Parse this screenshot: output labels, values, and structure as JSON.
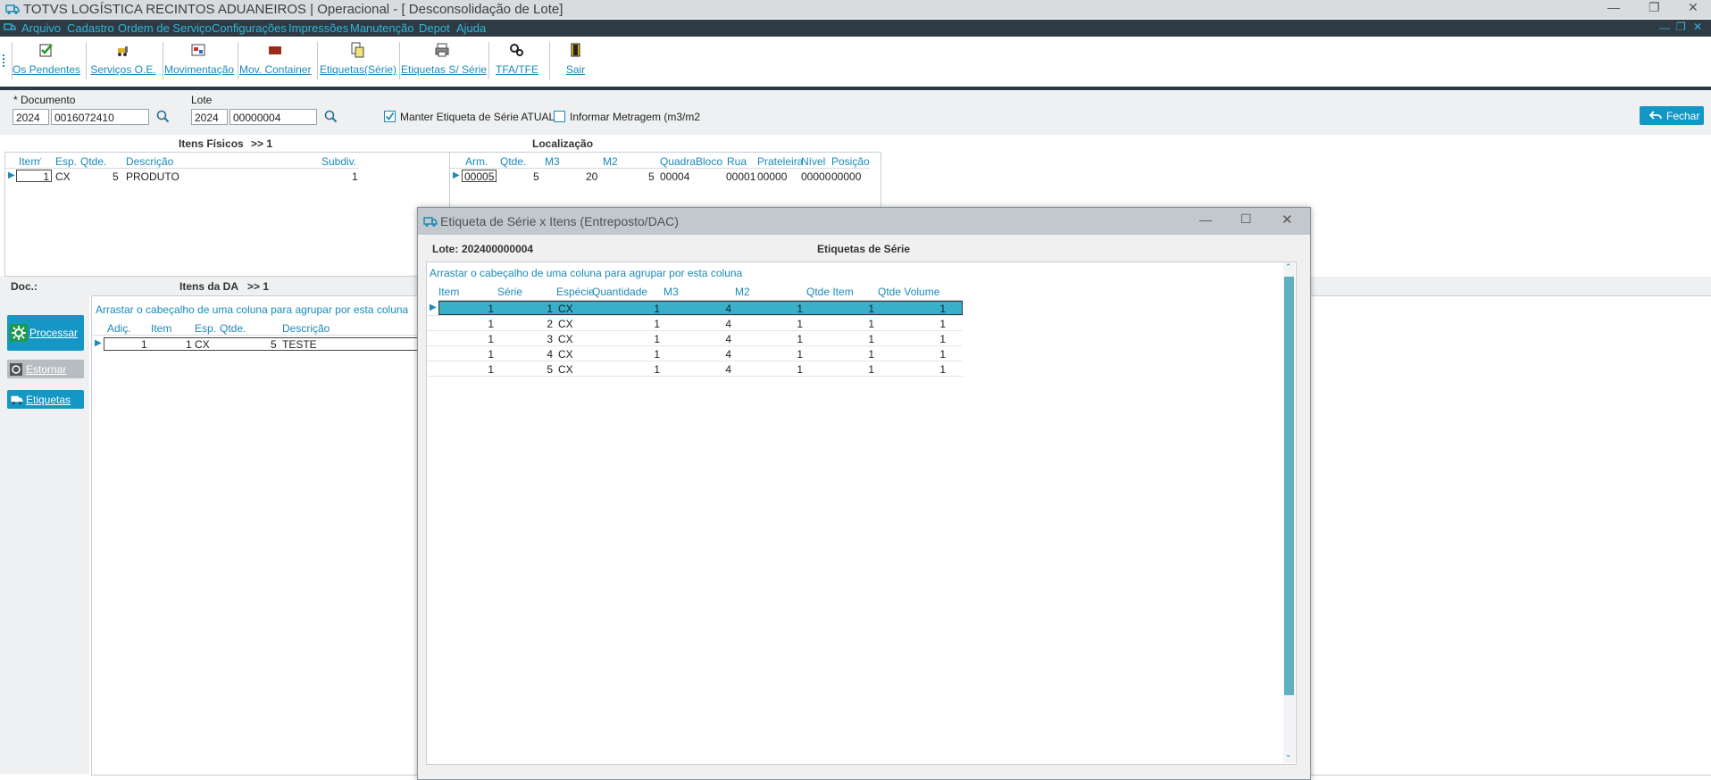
{
  "window": {
    "title": "TOTVS LOGÍSTICA RECINTOS ADUANEIROS | Operacional - [ Desconsolidação de Lote]"
  },
  "menu": [
    "Arquivo",
    "Cadastro",
    "Ordem de Serviço",
    "Configurações",
    "Impressões",
    "Manutenção",
    "Depot",
    "Ajuda"
  ],
  "toolbar": [
    "Os Pendentes",
    "Serviços O.E.",
    "Movimentação",
    "Mov. Container",
    "Etiquetas(Série)",
    "Etiquetas S/ Série",
    "TFA/TFE",
    "Sair"
  ],
  "form": {
    "documento_label": "* Documento",
    "documento_ano": "2024",
    "documento_num": "0016072410",
    "lote_label": "Lote",
    "lote_ano": "2024",
    "lote_num": "00000004",
    "chk1_label": "Manter Etiqueta de Série ATUAL",
    "chk2_label": "Informar Metragem (m3/m2",
    "fechar": "Fechar"
  },
  "itens_fisicos": {
    "title": "Itens Físicos",
    "count": ">> 1",
    "headers": [
      "Item",
      "Esp.",
      "Qtde.",
      "Descrição",
      "Subdiv."
    ],
    "rows": [
      [
        "1",
        "CX",
        "5",
        "PRODUTO",
        "1"
      ]
    ]
  },
  "localizacao": {
    "title": "Localização",
    "headers": [
      "Arm.",
      "Qtde.",
      "M3",
      "M2",
      "Quadra",
      "Bloco",
      "Rua",
      "Prateleira",
      "Nível",
      "Posição"
    ],
    "rows": [
      [
        "00005",
        "5",
        "20",
        "5",
        "00004",
        "",
        "00001",
        "00000",
        "00000",
        "00000"
      ]
    ]
  },
  "doc": {
    "label": "Doc.:"
  },
  "itens_da": {
    "title": "Itens da DA",
    "count": ">> 1",
    "group_hint": "Arrastar o cabeçalho de uma coluna para agrupar por esta coluna",
    "headers": [
      "Adiç.",
      "Item",
      "Esp.",
      "Qtde.",
      "Descrição"
    ],
    "rows": [
      [
        "1",
        "1",
        "CX",
        "5",
        "TESTE"
      ]
    ]
  },
  "side_buttons": {
    "processar": "Processar",
    "estornar": "Estornar",
    "etiquetas": "Etiquetas"
  },
  "modal": {
    "title": "Etiqueta de Série x Itens (Entreposto/DAC)",
    "lote_label": "Lote:",
    "lote_value": "202400000004",
    "heading": "Etiquetas de Série",
    "group_hint": "Arrastar o cabeçalho de uma coluna para agrupar por esta coluna",
    "headers": [
      "Item",
      "Série",
      "Espécie",
      "Quantidade",
      "M3",
      "M2",
      "Qtde Item",
      "Qtde Volume"
    ],
    "rows": [
      [
        "1",
        "1",
        "CX",
        "1",
        "4",
        "1",
        "1",
        "1"
      ],
      [
        "1",
        "2",
        "CX",
        "1",
        "4",
        "1",
        "1",
        "1"
      ],
      [
        "1",
        "3",
        "CX",
        "1",
        "4",
        "1",
        "1",
        "1"
      ],
      [
        "1",
        "4",
        "CX",
        "1",
        "4",
        "1",
        "1",
        "1"
      ],
      [
        "1",
        "5",
        "CX",
        "1",
        "4",
        "1",
        "1",
        "1"
      ]
    ]
  },
  "colors": {
    "accent": "#1497c4",
    "menubar": "#2e3a44",
    "selected_row": "#3aafca"
  }
}
